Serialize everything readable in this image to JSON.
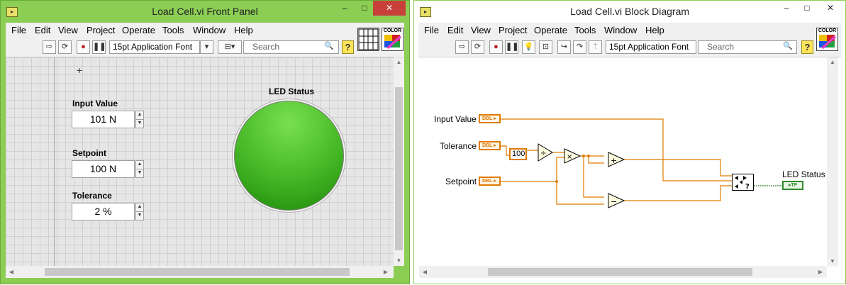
{
  "front_panel": {
    "title": "Load Cell.vi Front Panel",
    "window_controls": {
      "minimize": "–",
      "maximize": "□",
      "close": "✕"
    },
    "menu": [
      "File",
      "Edit",
      "View",
      "Project",
      "Operate",
      "Tools",
      "Window",
      "Help"
    ],
    "toolbar": {
      "font": "15pt Application Font",
      "search_placeholder": "Search",
      "help": "?"
    },
    "color_label": "COLOR",
    "controls": {
      "input_value": {
        "label": "Input Value",
        "value": "101 N"
      },
      "setpoint": {
        "label": "Setpoint",
        "value": "100 N"
      },
      "tolerance": {
        "label": "Tolerance",
        "value": "2 %"
      }
    },
    "led": {
      "label": "LED Status",
      "state": true,
      "color": "#45b625"
    },
    "cursor_glyph": "+"
  },
  "block_diagram": {
    "title": "Load Cell.vi Block Diagram",
    "window_controls": {
      "minimize": "–",
      "maximize": "□",
      "close": "✕"
    },
    "menu": [
      "File",
      "Edit",
      "View",
      "Project",
      "Operate",
      "Tools",
      "Window",
      "Help"
    ],
    "toolbar": {
      "font": "15pt Application Font",
      "search_placeholder": "Search",
      "help": "?"
    },
    "color_label": "COLOR",
    "terminals": {
      "input_value": {
        "label": "Input Value",
        "type": "DBL"
      },
      "tolerance": {
        "label": "Tolerance",
        "type": "DBL"
      },
      "setpoint": {
        "label": "Setpoint",
        "type": "DBL"
      },
      "led_status": {
        "label": "LED Status",
        "type": "TF"
      }
    },
    "constant": "100",
    "nodes": {
      "divide": "÷",
      "multiply": "×",
      "add": "+",
      "subtract": "−",
      "in_range": "?"
    },
    "wire_color": "#e07b00",
    "bool_color": "#2f8a2a"
  }
}
